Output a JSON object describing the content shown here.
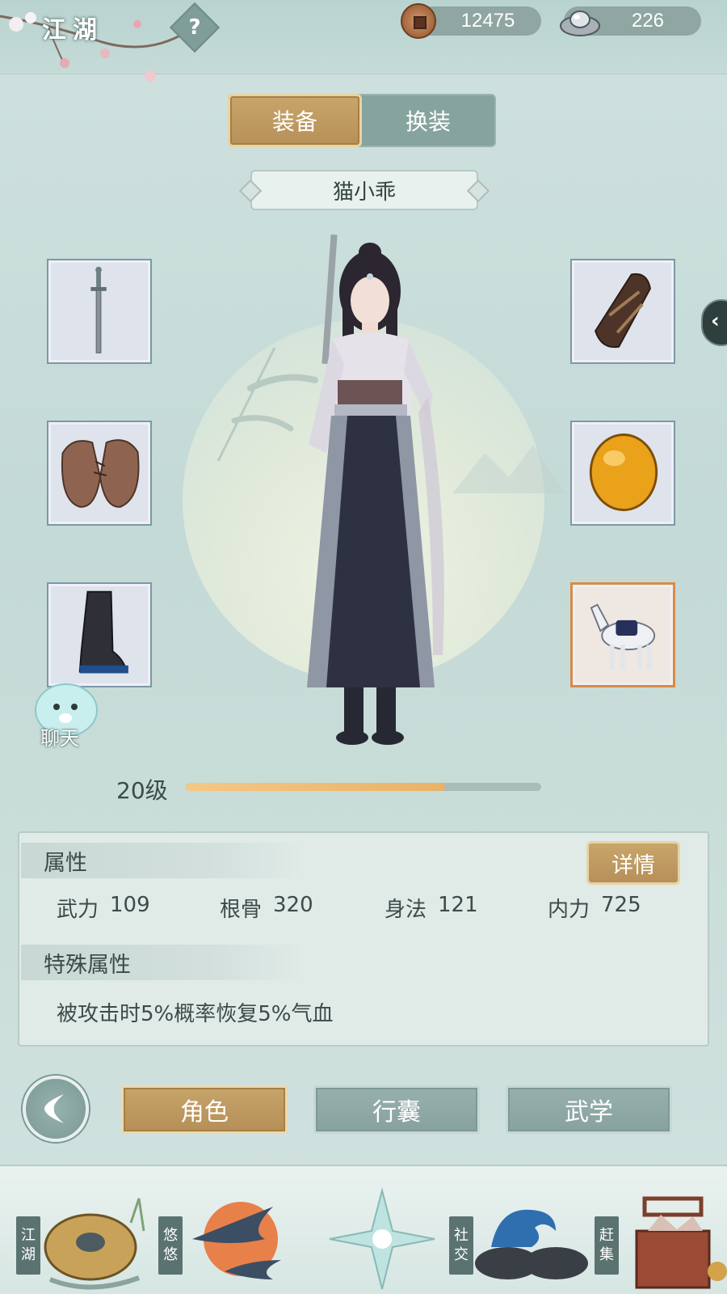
{
  "header": {
    "title": "江湖",
    "help_glyph": "?",
    "currencies": [
      {
        "icon": "copper-coin-icon",
        "value": "12475"
      },
      {
        "icon": "silver-ingot-icon",
        "value": "226"
      }
    ]
  },
  "tabs": {
    "equip": "装备",
    "outfit": "换装",
    "active": "装备"
  },
  "character": {
    "name": "猫小乖",
    "level_label": "20级",
    "level_progress_fraction": 0.73
  },
  "equipment": {
    "left": [
      "sword-icon",
      "leather-armor-icon",
      "boot-icon"
    ],
    "right": [
      "bracer-icon",
      "amber-gem-icon",
      "horse-icon"
    ]
  },
  "chat": {
    "label": "聊天"
  },
  "attributes": {
    "title": "属性",
    "details_button": "详情",
    "stats": [
      {
        "name": "武力",
        "value": "109"
      },
      {
        "name": "根骨",
        "value": "320"
      },
      {
        "name": "身法",
        "value": "121"
      },
      {
        "name": "内力",
        "value": "725"
      }
    ],
    "special_title": "特殊属性",
    "special_text": "被攻击时5%概率恢复5%气血"
  },
  "bottom_nav": {
    "items": [
      "角色",
      "行囊",
      "武学"
    ],
    "active": "角色"
  },
  "dock": {
    "items": [
      {
        "label": "江湖",
        "chars": [
          "江",
          "湖"
        ]
      },
      {
        "label": "悠悠",
        "chars": [
          "悠",
          "悠"
        ]
      },
      {
        "label": "",
        "chars": []
      },
      {
        "label": "社交",
        "chars": [
          "社",
          "交"
        ]
      },
      {
        "label": "赶集",
        "chars": [
          "赶",
          "集"
        ]
      }
    ]
  },
  "colors": {
    "background": "#c4dad6",
    "gold_accent": "#b69058",
    "teal_button": "#87a29e",
    "level_bar_fill": "#e9b266"
  }
}
